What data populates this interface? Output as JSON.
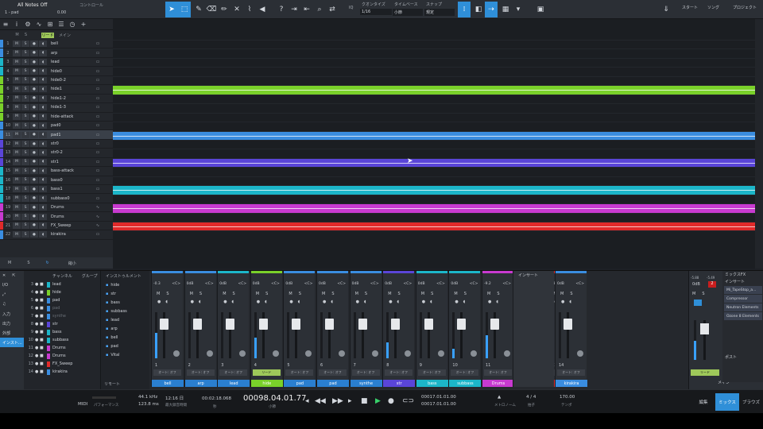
{
  "toolbar": {
    "song_title": "All Notes Off",
    "track_name": "1 - pad",
    "control_label": "コントロール",
    "control_value": "0.00",
    "quantize_label": "クオンタイズ",
    "quantize_value": "1/16",
    "timebase_label": "タイムベース",
    "timebase_value": "小節",
    "snap_label": "スナップ",
    "snap_value": "規定",
    "iq_label": "IQ",
    "start_label": "スタート",
    "song_label": "ソング",
    "project_label": "プロジェクト"
  },
  "track_panel": {
    "column_header": "メイン",
    "bottom": {
      "m": "M",
      "s": "S",
      "zoom": "縮小"
    },
    "tracks": [
      {
        "n": "1",
        "name": "bell",
        "color": "#3a8de0"
      },
      {
        "n": "2",
        "name": "arp",
        "color": "#3a8de0"
      },
      {
        "n": "3",
        "name": "lead",
        "color": "#1cb6c9"
      },
      {
        "n": "4",
        "name": "hide0",
        "color": "#1cb6c9"
      },
      {
        "n": "5",
        "name": "hide0-2",
        "color": "#7ad12a"
      },
      {
        "n": "6",
        "name": "hide1",
        "color": "#7ad12a"
      },
      {
        "n": "7",
        "name": "hide1-2",
        "color": "#7ad12a"
      },
      {
        "n": "8",
        "name": "hide1-3",
        "color": "#7ad12a"
      },
      {
        "n": "9",
        "name": "hide-attack",
        "color": "#7ad12a"
      },
      {
        "n": "10",
        "name": "pad0",
        "color": "#3a8de0"
      },
      {
        "n": "11",
        "name": "pad1",
        "color": "#3a8de0"
      },
      {
        "n": "12",
        "name": "str0",
        "color": "#5a45d8"
      },
      {
        "n": "13",
        "name": "str0-2",
        "color": "#5a45d8"
      },
      {
        "n": "14",
        "name": "str1",
        "color": "#5a45d8"
      },
      {
        "n": "15",
        "name": "bass-attack",
        "color": "#1cb6c9"
      },
      {
        "n": "16",
        "name": "bass0",
        "color": "#1cb6c9"
      },
      {
        "n": "17",
        "name": "bass1",
        "color": "#1cb6c9"
      },
      {
        "n": "18",
        "name": "subbass0",
        "color": "#1cb6c9"
      },
      {
        "n": "19",
        "name": "Drums",
        "color": "#c83ad0"
      },
      {
        "n": "20",
        "name": "Drums",
        "color": "#c83ad0"
      },
      {
        "n": "21",
        "name": "FX_Sweep",
        "color": "#e02a2a"
      },
      {
        "n": "22",
        "name": "kirakira",
        "color": "#3a8de0"
      }
    ],
    "m_label": "M",
    "s_label": "S"
  },
  "mixer": {
    "side_tabs": [
      "I/O",
      "",
      "",
      "入力",
      "出力",
      "外部",
      "インスト..."
    ],
    "channel_header": "チャンネル",
    "group_header": "グループ",
    "instrument_header": "インストゥルメント",
    "remote_label": "リモート",
    "channel_list": [
      {
        "n": "3",
        "name": "lead",
        "color": "#1cb6c9"
      },
      {
        "n": "4",
        "name": "hide",
        "color": "#7ad12a"
      },
      {
        "n": "5",
        "name": "pad",
        "color": "#3a8de0"
      },
      {
        "n": "6",
        "name": "pad",
        "color": "#3a8de0"
      },
      {
        "n": "7",
        "name": "synthe",
        "color": "#3a8de0"
      },
      {
        "n": "8",
        "name": "str",
        "color": "#5a45d8"
      },
      {
        "n": "9",
        "name": "bass",
        "color": "#1cb6c9"
      },
      {
        "n": "10",
        "name": "subbass",
        "color": "#1cb6c9"
      },
      {
        "n": "11",
        "name": "Drums",
        "color": "#c83ad0"
      },
      {
        "n": "12",
        "name": "Drums",
        "color": "#c83ad0"
      },
      {
        "n": "13",
        "name": "FX_Sweep",
        "color": "#e02a2a"
      },
      {
        "n": "14",
        "name": "kirakira",
        "color": "#3a8de0"
      }
    ],
    "instruments": [
      "hide",
      "str",
      "bass",
      "subbass",
      "lead",
      "arp",
      "bell",
      "pad",
      "Vital"
    ],
    "strips": [
      {
        "n": "1",
        "name": "bell",
        "vol": "-0.3",
        "pan": "<C>",
        "color": "#3a8de0",
        "label_color": "#2a7fd0",
        "auto": "オート: オフ",
        "read": false,
        "level": 0.55
      },
      {
        "n": "2",
        "name": "arp",
        "vol": "0dB",
        "pan": "<C>",
        "color": "#3a8de0",
        "label_color": "#2a7fd0",
        "auto": "オート: オフ",
        "read": false,
        "level": 0.0
      },
      {
        "n": "3",
        "name": "lead",
        "vol": "0dB",
        "pan": "<C>",
        "color": "#1cb6c9",
        "label_color": "#2a7fd0",
        "auto": "オート: オフ",
        "read": false,
        "level": 0.0
      },
      {
        "n": "4",
        "name": "hide",
        "vol": "0dB",
        "pan": "<C>",
        "color": "#7ad12a",
        "label_color": "#7ad12a",
        "auto": "リード",
        "read": true,
        "level": 0.45
      },
      {
        "n": "5",
        "name": "pad",
        "vol": "0dB",
        "pan": "<C>",
        "color": "#3a8de0",
        "label_color": "#2a7fd0",
        "auto": "オート: オフ",
        "read": false,
        "level": 0.0
      },
      {
        "n": "6",
        "name": "pad",
        "vol": "0dB",
        "pan": "<C>",
        "color": "#3a8de0",
        "label_color": "#2a7fd0",
        "auto": "オート: オフ",
        "read": false,
        "level": 0.0
      },
      {
        "n": "7",
        "name": "synthe",
        "vol": "0dB",
        "pan": "<C>",
        "color": "#3a8de0",
        "label_color": "#2a7fd0",
        "auto": "オート: オフ",
        "read": false,
        "level": 0.0
      },
      {
        "n": "8",
        "name": "str",
        "vol": "0dB",
        "pan": "<C>",
        "color": "#5a45d8",
        "label_color": "#5a45d8",
        "auto": "オート: オフ",
        "read": false,
        "level": 0.35
      },
      {
        "n": "9",
        "name": "bass",
        "vol": "0dB",
        "pan": "<C>",
        "color": "#1cb6c9",
        "label_color": "#1cb6c9",
        "auto": "オート: オフ",
        "read": false,
        "level": 0.0
      },
      {
        "n": "10",
        "name": "subbass",
        "vol": "0dB",
        "pan": "<C>",
        "color": "#1cb6c9",
        "label_color": "#1cb6c9",
        "auto": "オート: オフ",
        "read": false,
        "level": 0.2
      },
      {
        "n": "11",
        "name": "Drums",
        "vol": "-9.2",
        "pan": "<C>",
        "color": "#c83ad0",
        "label_color": "#c83ad0",
        "auto": "オート: オフ",
        "read": false,
        "level": 0.5
      },
      {
        "n": "12",
        "name": "Drums",
        "vol": "-9.2",
        "pan": "<C>",
        "color": "#c83ad0",
        "label_color": "#c83ad0",
        "auto": "オート: オフ",
        "read": false,
        "level": 0.45
      },
      {
        "n": "13",
        "name": "FX_Sweep",
        "vol": "-18.9",
        "pan": "<C>",
        "color": "#e02a2a",
        "label_color": "#e02a2a",
        "auto": "オート: オフ",
        "read": false,
        "level": 0.3
      }
    ],
    "insert_label": "インサート",
    "strip14": {
      "n": "14",
      "name": "kirakira",
      "vol": "0dB",
      "pan": "<C>",
      "color": "#3a8de0",
      "auto": "オート: オフ"
    },
    "main": {
      "vol_l": "-5.88",
      "vol_r": "-5.49",
      "vol": "0dB",
      "badge": "2",
      "label": "メイン",
      "auto": "リード",
      "fx_header": "ミックスFX",
      "insert_header": "インサート",
      "inserts": [
        "Mi_TapeStop_a...",
        "Compressor",
        "Neutron Elements",
        "Ozone 8 Elements"
      ],
      "post_label": "ポスト"
    }
  },
  "transport": {
    "midi_label": "MIDI",
    "performance_label": "パフォーマンス",
    "sample_rate": "44.1 kHz",
    "latency": "123.8 ms",
    "day_label": "12:16 日",
    "record_max": "最大録音時間",
    "time": "00:02:18.068",
    "time_label": "秒",
    "position": "00098.04.01.77",
    "position_label": "小節",
    "loop_start": "00017.01.01.00",
    "loop_end": "00017.01.01.00",
    "signature": "4 / 4",
    "metronome": "メトロノーム",
    "beat_label": "拍子",
    "tempo": "170.00",
    "tempo_label": "テンポ",
    "views": [
      "編集",
      "ミックス",
      "ブラウズ"
    ]
  }
}
